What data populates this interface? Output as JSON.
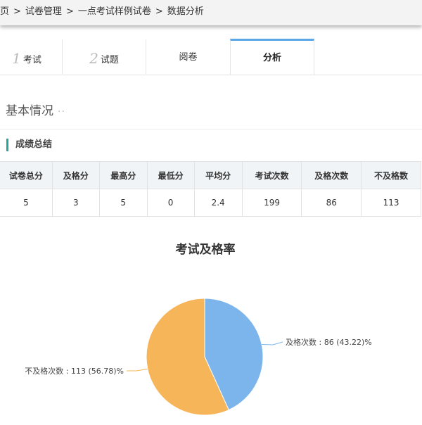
{
  "breadcrumb": {
    "items": [
      "页",
      "试卷管理",
      "一点考试样例试卷",
      "数据分析"
    ],
    "separator": ">"
  },
  "tabs": [
    {
      "num": "1",
      "label": "考试"
    },
    {
      "num": "2",
      "label": "试题"
    },
    {
      "num": "",
      "label": "阅卷"
    },
    {
      "num": "",
      "label": "分析",
      "active": true
    }
  ],
  "section": {
    "title": "基本情况",
    "dots": "··"
  },
  "summary": {
    "title": "成绩总结",
    "headers": [
      "试卷总分",
      "及格分",
      "最高分",
      "最低分",
      "平均分",
      "考试次数",
      "及格次数",
      "不及格数"
    ],
    "values": [
      "5",
      "3",
      "5",
      "0",
      "2.4",
      "199",
      "86",
      "113"
    ]
  },
  "chart_data": {
    "type": "pie",
    "title": "考试及格率",
    "slices": [
      {
        "label": "及格次数",
        "value": 86,
        "percent": 43.22,
        "color": "#7cb5ec",
        "text": "及格次数 : 86 (43.22)%"
      },
      {
        "label": "不及格次数",
        "value": 113,
        "percent": 56.78,
        "color": "#f7b55a",
        "text": "不及格次数 : 113 (56.78)%"
      }
    ]
  },
  "colors": {
    "accent": "#5aa7e8",
    "subtitle_bar": "#26a69a",
    "table_header_bg": "#f0f4f7"
  }
}
